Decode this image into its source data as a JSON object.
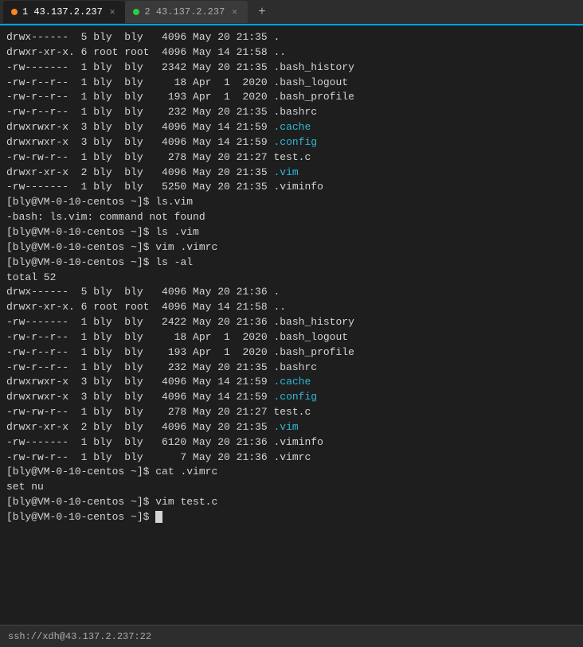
{
  "tabs": [
    {
      "id": 1,
      "label": "1 43.137.2.237",
      "active": true,
      "dot": "orange"
    },
    {
      "id": 2,
      "label": "2 43.137.2.237",
      "active": false,
      "dot": "green"
    }
  ],
  "terminal": {
    "lines": [
      {
        "type": "plain",
        "text": "drwx------  5 bly  bly   4096 May 20 21:35 ."
      },
      {
        "type": "plain",
        "text": "drwxr-xr-x. 6 root root  4096 May 14 21:58 .."
      },
      {
        "type": "plain",
        "text": "-rw-------  1 bly  bly   2342 May 20 21:35 .bash_history"
      },
      {
        "type": "plain",
        "text": "-rw-r--r--  1 bly  bly     18 Apr  1  2020 .bash_logout"
      },
      {
        "type": "plain",
        "text": "-rw-r--r--  1 bly  bly    193 Apr  1  2020 .bash_profile"
      },
      {
        "type": "plain",
        "text": "-rw-r--r--  1 bly  bly    232 May 20 21:35 .bashrc"
      },
      {
        "type": "cyan-suffix",
        "text": "drwxrwxr-x  3 bly  bly   4096 May 14 21:59 ",
        "suffix": ".cache"
      },
      {
        "type": "cyan-suffix",
        "text": "drwxrwxr-x  3 bly  bly   4096 May 14 21:59 ",
        "suffix": ".config"
      },
      {
        "type": "plain",
        "text": "-rw-rw-r--  1 bly  bly    278 May 20 21:27 test.c"
      },
      {
        "type": "cyan-suffix",
        "text": "drwxr-xr-x  2 bly  bly   4096 May 20 21:35 ",
        "suffix": ".vim"
      },
      {
        "type": "plain",
        "text": "-rw-------  1 bly  bly   5250 May 20 21:35 .viminfo"
      },
      {
        "type": "prompt",
        "text": "[bly@VM-0-10-centos ~]$ ",
        "cmd": "ls.vim"
      },
      {
        "type": "plain",
        "text": "-bash: ls.vim: command not found"
      },
      {
        "type": "prompt",
        "text": "[bly@VM-0-10-centos ~]$ ",
        "cmd": "ls .vim"
      },
      {
        "type": "prompt",
        "text": "[bly@VM-0-10-centos ~]$ ",
        "cmd": "vim .vimrc"
      },
      {
        "type": "prompt",
        "text": "[bly@VM-0-10-centos ~]$ ",
        "cmd": "ls -al"
      },
      {
        "type": "plain",
        "text": "total 52"
      },
      {
        "type": "plain",
        "text": "drwx------  5 bly  bly   4096 May 20 21:36 ."
      },
      {
        "type": "plain",
        "text": "drwxr-xr-x. 6 root root  4096 May 14 21:58 .."
      },
      {
        "type": "plain",
        "text": "-rw-------  1 bly  bly   2422 May 20 21:36 .bash_history"
      },
      {
        "type": "plain",
        "text": "-rw-r--r--  1 bly  bly     18 Apr  1  2020 .bash_logout"
      },
      {
        "type": "plain",
        "text": "-rw-r--r--  1 bly  bly    193 Apr  1  2020 .bash_profile"
      },
      {
        "type": "plain",
        "text": "-rw-r--r--  1 bly  bly    232 May 20 21:35 .bashrc"
      },
      {
        "type": "cyan-suffix",
        "text": "drwxrwxr-x  3 bly  bly   4096 May 14 21:59 ",
        "suffix": ".cache"
      },
      {
        "type": "cyan-suffix",
        "text": "drwxrwxr-x  3 bly  bly   4096 May 14 21:59 ",
        "suffix": ".config"
      },
      {
        "type": "plain",
        "text": "-rw-rw-r--  1 bly  bly    278 May 20 21:27 test.c"
      },
      {
        "type": "cyan-suffix",
        "text": "drwxr-xr-x  2 bly  bly   4096 May 20 21:35 ",
        "suffix": ".vim"
      },
      {
        "type": "plain",
        "text": "-rw-------  1 bly  bly   6120 May 20 21:36 .viminfo"
      },
      {
        "type": "plain",
        "text": "-rw-rw-r--  1 bly  bly      7 May 20 21:36 .vimrc"
      },
      {
        "type": "prompt",
        "text": "[bly@VM-0-10-centos ~]$ ",
        "cmd": "cat .vimrc"
      },
      {
        "type": "plain",
        "text": "set nu"
      },
      {
        "type": "prompt",
        "text": "[bly@VM-0-10-centos ~]$ ",
        "cmd": "vim test.c"
      },
      {
        "type": "prompt-cursor",
        "text": "[bly@VM-0-10-centos ~]$ "
      }
    ]
  },
  "statusbar": {
    "text": "ssh://xdh@43.137.2.237:22"
  }
}
